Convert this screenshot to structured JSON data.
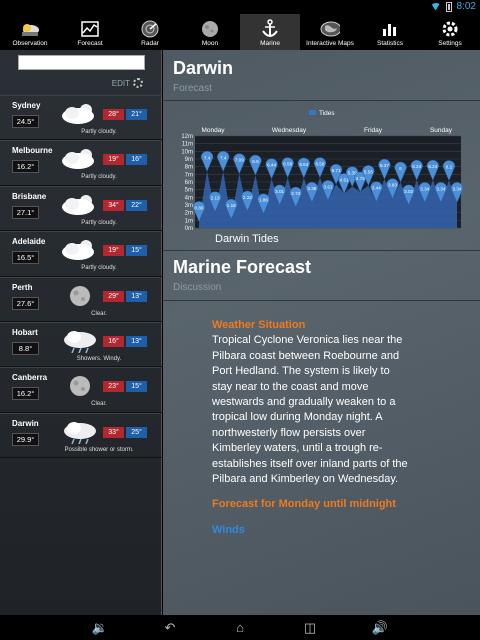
{
  "status": {
    "time": "8:02"
  },
  "tabs": [
    {
      "label": "Observation",
      "icon": "observation-icon"
    },
    {
      "label": "Forecast",
      "icon": "forecast-icon"
    },
    {
      "label": "Radar",
      "icon": "radar-icon"
    },
    {
      "label": "Moon",
      "icon": "moon-icon"
    },
    {
      "label": "Marine",
      "icon": "anchor-icon"
    },
    {
      "label": "Interactive Maps",
      "icon": "map-icon"
    },
    {
      "label": "Statistics",
      "icon": "statistics-icon"
    },
    {
      "label": "Settings",
      "icon": "gear-icon"
    }
  ],
  "sidebar": {
    "search_value": "",
    "edit_label": "EDIT",
    "cities": [
      {
        "name": "Sydney",
        "temp": "24.5°",
        "max": "28°",
        "min": "21°",
        "desc": "Partly cloudy."
      },
      {
        "name": "Melbourne",
        "temp": "16.2°",
        "max": "19°",
        "min": "16°",
        "desc": "Partly cloudy."
      },
      {
        "name": "Brisbane",
        "temp": "27.1°",
        "max": "34°",
        "min": "22°",
        "desc": "Partly cloudy."
      },
      {
        "name": "Adelaide",
        "temp": "16.5°",
        "max": "19°",
        "min": "15°",
        "desc": "Partly cloudy."
      },
      {
        "name": "Perth",
        "temp": "27.6°",
        "max": "29°",
        "min": "13°",
        "desc": "Clear."
      },
      {
        "name": "Hobart",
        "temp": "8.8°",
        "max": "16°",
        "min": "13°",
        "desc": "Showers. Windy."
      },
      {
        "name": "Canberra",
        "temp": "16.2°",
        "max": "23°",
        "min": "15°",
        "desc": "Clear."
      },
      {
        "name": "Darwin",
        "temp": "29.9°",
        "max": "33°",
        "min": "25°",
        "desc": "Possible shower or storm."
      }
    ]
  },
  "main": {
    "city_title": "Darwin",
    "forecast_sub": "Forecast",
    "chart_caption": "Darwin Tides",
    "marine_title": "Marine Forecast",
    "discussion_sub": "Discussion",
    "situation_heading": "Weather Situation",
    "situation_text": "Tropical Cyclone Veronica lies near the Pilbara coast between Roebourne and Port Hedland. The system is likely to stay near to the coast and move westwards and gradually weaken to a tropical low during Monday night. A northwesterly flow persists over Kimberley waters, until a trough re-establishes itself over inland parts of the Pilbara and Kimberley on Wednesday.",
    "forecast_heading": "Forecast for Monday until midnight",
    "winds_heading": "Winds"
  },
  "chart_data": {
    "type": "area",
    "legend": [
      "Tides"
    ],
    "legend_position": "top",
    "days": [
      "Monday",
      "Wednesday",
      "Friday",
      "Sunday"
    ],
    "y_ticks": [
      "0m",
      "1m",
      "2m",
      "3m",
      "4m",
      "5m",
      "6m",
      "7m",
      "8m",
      "9m",
      "10m",
      "11m",
      "12m"
    ],
    "ylim": [
      0,
      12
    ],
    "grid": true,
    "series": [
      {
        "name": "Tides",
        "values": [
          0.86,
          7.4,
          2.13,
          7.4,
          1.16,
          7.09,
          2.22,
          6.9,
          1.86,
          6.44,
          3.01,
          6.58,
          2.73,
          6.54,
          3.36,
          6.58,
          3.61,
          5.71,
          4.51,
          5.39,
          4.72,
          5.56,
          3.44,
          6.37,
          3.83,
          6.0,
          3.02,
          6.24,
          3.34,
          6.24,
          3.34,
          6.2,
          3.34
        ]
      }
    ]
  },
  "navbar": {
    "items": [
      "volume-down-icon",
      "back-icon",
      "home-icon",
      "recent-apps-icon",
      "volume-up-icon"
    ]
  }
}
